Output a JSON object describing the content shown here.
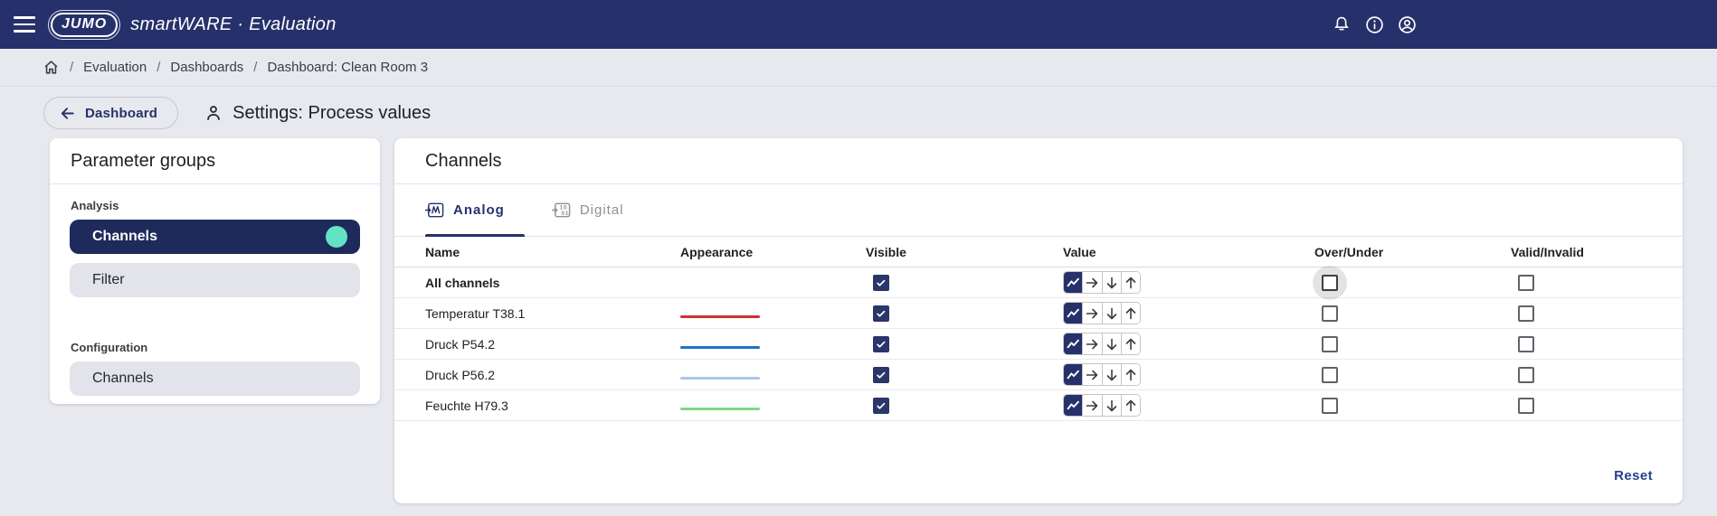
{
  "colors": {
    "topbar_navy": "#26316b",
    "selected_navy": "#1e2a5b",
    "accent_teal": "#62e3c5",
    "reset_link": "#24418e"
  },
  "topbar": {
    "logo_text": "JUMO",
    "brand": "smartWARE · Evaluation",
    "icons": [
      "hamburger-menu-icon",
      "bell-icon",
      "info-icon",
      "account-icon"
    ]
  },
  "breadcrumb": {
    "separator": "/",
    "items": [
      "Evaluation",
      "Dashboards",
      "Dashboard: Clean Room 3"
    ]
  },
  "toolbar": {
    "back_label": "Dashboard",
    "title": "Settings: Process values"
  },
  "sidebar": {
    "title": "Parameter groups",
    "groups": [
      {
        "label": "Analysis",
        "items": [
          {
            "label": "Channels",
            "selected": true
          },
          {
            "label": "Filter",
            "selected": false
          }
        ]
      },
      {
        "label": "Configuration",
        "items": [
          {
            "label": "Channels",
            "selected": false
          }
        ]
      }
    ]
  },
  "main": {
    "title": "Channels",
    "tabs": [
      {
        "label": "Analog",
        "icon": "analog-wave-icon",
        "active": true
      },
      {
        "label": "Digital",
        "icon": "digital-binary-icon",
        "active": false
      }
    ],
    "table": {
      "columns": [
        "Name",
        "Appearance",
        "Visible",
        "Value",
        "Over/Under",
        "Valid/Invalid"
      ],
      "value_modes": [
        "trend",
        "right-arrow",
        "down-arrow",
        "up-arrow"
      ],
      "rows": [
        {
          "name": "All channels",
          "bold": true,
          "line_color": null,
          "visible": true,
          "value_selected": "trend",
          "over_under": false,
          "valid_invalid": false,
          "over_under_focused": true
        },
        {
          "name": "Temperatur T38.1",
          "bold": false,
          "line_color": "#cf2e2e",
          "visible": true,
          "value_selected": "trend",
          "over_under": false,
          "valid_invalid": false,
          "over_under_focused": false
        },
        {
          "name": "Druck P54.2",
          "bold": false,
          "line_color": "#1c72cc",
          "visible": true,
          "value_selected": "trend",
          "over_under": false,
          "valid_invalid": false,
          "over_under_focused": false
        },
        {
          "name": "Druck P56.2",
          "bold": false,
          "line_color": "#abc7e9",
          "visible": true,
          "value_selected": "trend",
          "over_under": false,
          "valid_invalid": false,
          "over_under_focused": false
        },
        {
          "name": "Feuchte H79.3",
          "bold": false,
          "line_color": "#80d783",
          "visible": true,
          "value_selected": "trend",
          "over_under": false,
          "valid_invalid": false,
          "over_under_focused": false
        }
      ]
    },
    "reset_label": "Reset"
  }
}
